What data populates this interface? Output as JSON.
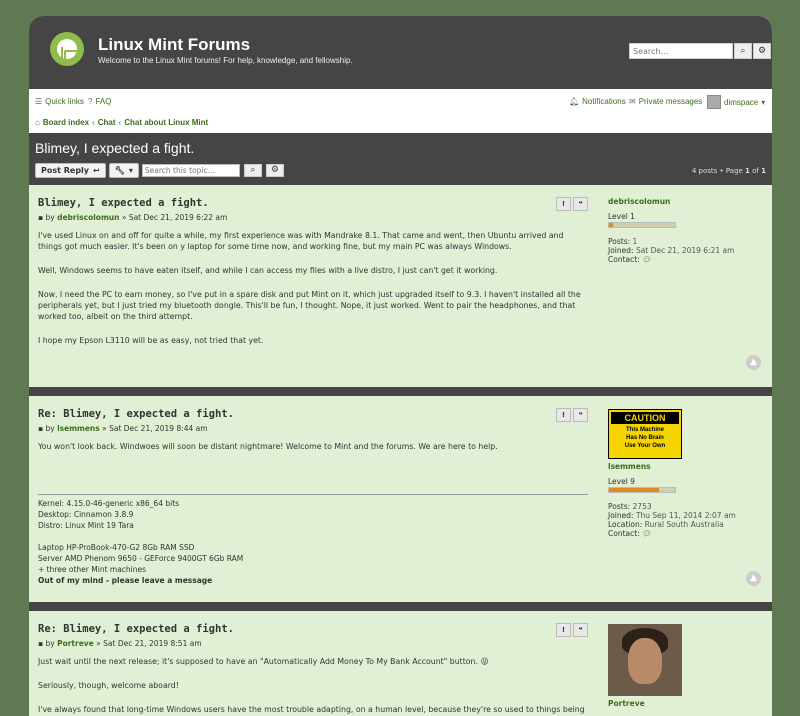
{
  "site": {
    "title": "Linux Mint Forums",
    "description": "Welcome to the Linux Mint forums! For help, knowledge, and fellowship.",
    "search_placeholder": "Search…"
  },
  "nav": {
    "quick_links": "Quick links",
    "faq": "FAQ",
    "notifications": "Notifications",
    "private_messages": "Private messages",
    "username": "dimspace",
    "breadcrumb": [
      "Board index",
      "Chat",
      "Chat about Linux Mint"
    ]
  },
  "topic": {
    "title": "Blimey, I expected a fight.",
    "post_reply": "Post Reply",
    "search_placeholder": "Search this topic…",
    "pagination": {
      "posts": "4 posts • Page ",
      "current": "1",
      "of": " of ",
      "total": "1"
    }
  },
  "posts": [
    {
      "title": "Blimey, I expected a fight.",
      "by": "by",
      "author": "debriscolomun",
      "date": "» Sat Dec 21, 2019 6:22 am",
      "paragraphs": [
        "I've used Linux on and off for quite a while, my first experience was with Mandrake 8.1. That came and went, then Ubuntu arrived and things got much easier. It's been on y laptop for some time now, and working fine, but my main PC was always Windows.",
        "Well, Windows seems to have eaten itself, and while I can access my files with a live distro, I just can't get it working.",
        "Now, I need the PC to earn money, so I've put in a spare disk and put Mint on it, which just upgraded itself to 9.3. I haven't installed all the peripherals yet, but I just tried my bluetooth dongle. This'll be fun, I thought. Nope, it just worked. Went to pair the headphones, and that worked too, albeit on the third attempt.",
        "I hope my Epson L3110 will be as easy, not tried that yet."
      ],
      "profile": {
        "username": "debriscolomun",
        "rank": "Level 1",
        "rank_fill": 0.06,
        "posts_label": "Posts:",
        "posts": "1",
        "joined_label": "Joined:",
        "joined": "Sat Dec 21, 2019 6:21 am",
        "contact_label": "Contact:"
      }
    },
    {
      "title": "Re: Blimey, I expected a fight.",
      "by": "by",
      "author": "lsemmens",
      "date": "» Sat Dec 21, 2019 8:44 am",
      "paragraphs": [
        "You won't look back. Windwoes will soon be distant nightmare! Welcome to Mint and the forums. We are here to help."
      ],
      "signature": [
        "Kernel: 4.15.0-46-generic x86_64 bits",
        "Desktop: Cinnamon 3.8.9",
        "Distro: Linux Mint 19 Tara",
        "",
        "Laptop HP-ProBook-470-G2 8Gb RAM SSD",
        "Server AMD Phenom 9650 - GEForce 9400GT 6Gb RAM",
        "+ three other Mint machines"
      ],
      "signature_bold": "Out of my mind - please leave a message",
      "profile": {
        "avatar_lines": [
          "CAUTION",
          "This Machine",
          "Has No Brain",
          "Use Your Own"
        ],
        "username": "lsemmens",
        "rank": "Level 9",
        "rank_fill": 0.75,
        "posts_label": "Posts:",
        "posts": "2753",
        "joined_label": "Joined:",
        "joined": "Thu Sep 11, 2014 2:07 am",
        "location_label": "Location:",
        "location": "Rural South Australia",
        "contact_label": "Contact:"
      }
    },
    {
      "title": "Re: Blimey, I expected a fight.",
      "by": "by",
      "author": "Portreve",
      "date": "» Sat Dec 21, 2019 8:51 am",
      "paragraphs": [
        "Just wait until the next release; it's supposed to have an \"Automatically Add Money To My Bank Account\" button. 😜",
        "Seriously, though, welcome aboard!",
        "I've always found that long-time Windows users have the most trouble adapting, on a human level, because they're so used to things being"
      ],
      "profile": {
        "username": "Portreve"
      }
    }
  ]
}
